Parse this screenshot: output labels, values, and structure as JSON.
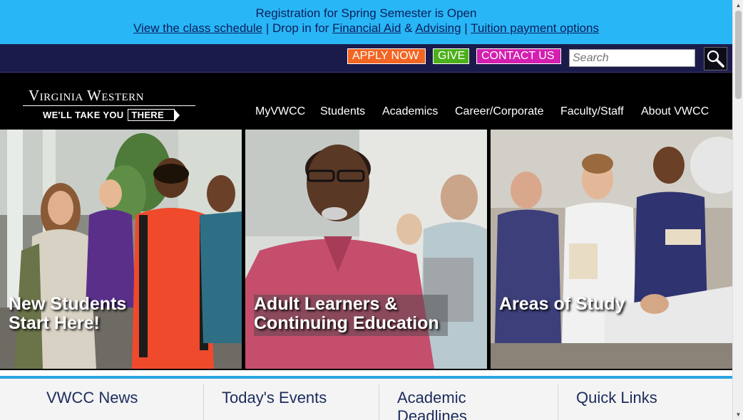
{
  "alert": {
    "headline": "Registration for Spring Semester is Open",
    "link_schedule": "View the class schedule",
    "sep1": " | ",
    "drop_text": "Drop in for ",
    "link_financial": "Financial Aid",
    "amp": " & ",
    "link_advising": "Advising",
    "sep2": " | ",
    "link_tuition": "Tuition payment options",
    "background": "#29b6f6"
  },
  "utility": {
    "apply_label": "APPLY NOW",
    "give_label": "GIVE",
    "contact_label": "CONTACT US",
    "search_placeholder": "Search",
    "search_icon": "magnifier-icon",
    "colors": {
      "apply": "#f26522",
      "give": "#4caf1a",
      "contact": "#d41fb0",
      "bar": "#1b1b4b"
    }
  },
  "header": {
    "logo_name": "Virginia Western",
    "logo_tagline": "WE'LL TAKE YOU",
    "logo_tagline_end": "THERE",
    "nav": [
      "MyVWCC",
      "Students",
      "Academics",
      "Career/Corporate",
      "Faculty/Staff",
      "About VWCC"
    ]
  },
  "tiles": [
    {
      "label_line1": "New Students",
      "label_line2": "Start Here!"
    },
    {
      "label_line1": "Adult Learners &",
      "label_line2": "Continuing Education"
    },
    {
      "label_line1": "Areas of Study",
      "label_line2": ""
    }
  ],
  "columns": {
    "news": "VWCC News",
    "events": "Today's Events",
    "deadlines_line1": "Academic",
    "deadlines_line2": "Deadlines",
    "quicklinks": "Quick Links"
  },
  "accent_color": "#2aa6e0"
}
